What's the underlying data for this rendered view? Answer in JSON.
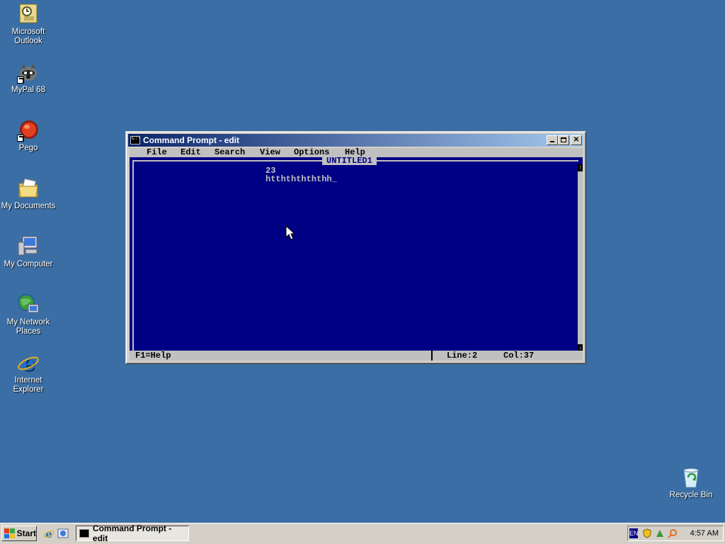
{
  "desktop": {
    "icons": [
      {
        "label": "Microsoft Outlook",
        "icon": "outlook-icon"
      },
      {
        "label": "MyPal 68",
        "icon": "mypal-icon"
      },
      {
        "label": "Pego",
        "icon": "pego-icon"
      },
      {
        "label": "My Documents",
        "icon": "my-documents-icon"
      },
      {
        "label": "My Computer",
        "icon": "my-computer-icon"
      },
      {
        "label": "My Network Places",
        "icon": "network-places-icon"
      },
      {
        "label": "Internet Explorer",
        "icon": "internet-explorer-icon"
      },
      {
        "label": "Recycle Bin",
        "icon": "recycle-bin-icon"
      }
    ]
  },
  "window": {
    "title": "Command Prompt - edit",
    "menu": [
      "File",
      "Edit",
      "Search",
      "View",
      "Options",
      "Help"
    ],
    "document_title": "UNTITLED1",
    "lines": [
      "23",
      "htthththththh"
    ],
    "cursor": "_",
    "status": {
      "help": "F1=Help",
      "line": "Line:2",
      "col": "Col:37"
    }
  },
  "taskbar": {
    "start_label": "Start",
    "task_label": "Command Prompt - edit",
    "language": "EN",
    "clock": "4:57 AM"
  }
}
